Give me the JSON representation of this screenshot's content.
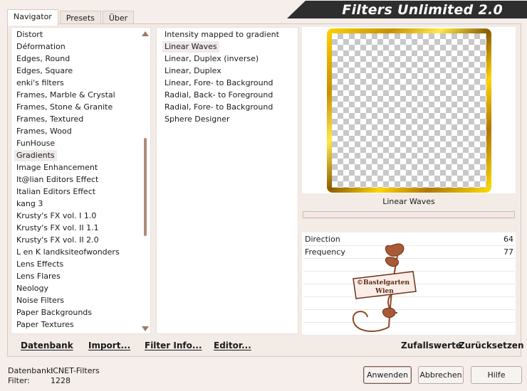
{
  "app": {
    "title": "Filters Unlimited 2.0"
  },
  "tabs": [
    {
      "label": "Navigator",
      "active": true
    },
    {
      "label": "Presets",
      "active": false
    },
    {
      "label": "Über",
      "active": false
    }
  ],
  "categories": {
    "selected": "Gradients",
    "items": [
      "Distort",
      "Déformation",
      "Edges, Round",
      "Edges, Square",
      "enki's filters",
      "Frames, Marble & Crystal",
      "Frames, Stone & Granite",
      "Frames, Textured",
      "Frames, Wood",
      "FunHouse",
      "Gradients",
      "Image Enhancement",
      "It@lian Editors Effect",
      "Italian Editors Effect",
      "kang 3",
      "Krusty's FX vol. I 1.0",
      "Krusty's FX vol. II 1.1",
      "Krusty's FX vol. II 2.0",
      "L en K landksiteofwonders",
      "Lens Effects",
      "Lens Flares",
      "Neology",
      "Noise Filters",
      "Paper Backgrounds",
      "Paper Textures"
    ]
  },
  "filters": {
    "selected": "Linear Waves",
    "items": [
      "Intensity mapped to gradient",
      "Linear Waves",
      "Linear, Duplex (inverse)",
      "Linear, Duplex",
      "Linear, Fore- to Background",
      "Radial, Back- to Foreground",
      "Radial, Fore- to Background",
      "Sphere Designer"
    ]
  },
  "preview": {
    "filter_name": "Linear Waves"
  },
  "parameters": [
    {
      "label": "Direction",
      "value": "64"
    },
    {
      "label": "Frequency",
      "value": "77"
    }
  ],
  "watermark": {
    "line1": "©Bastelgarten",
    "line2": "Wien"
  },
  "bottom_bar": {
    "datenbank": "Datenbank",
    "import": "Import...",
    "filter_info": "Filter Info...",
    "editor": "Editor...",
    "zufallswerte": "Zufallswerte",
    "zuruecksetzen": "Zurücksetzen"
  },
  "status": {
    "db_label": "Datenbank:",
    "db_value": "ICNET-Filters",
    "filter_label": "Filter:",
    "filter_value": "1228"
  },
  "buttons": {
    "apply": "Anwenden",
    "cancel": "Abbrechen",
    "help": "Hilfe"
  },
  "colors": {
    "background": "#f5eeea",
    "banner": "#2e2e2e",
    "scroll_thumb": "#b08a7a",
    "frame_gold": "#ffd400",
    "watermark_brown": "#8b4a2b"
  }
}
